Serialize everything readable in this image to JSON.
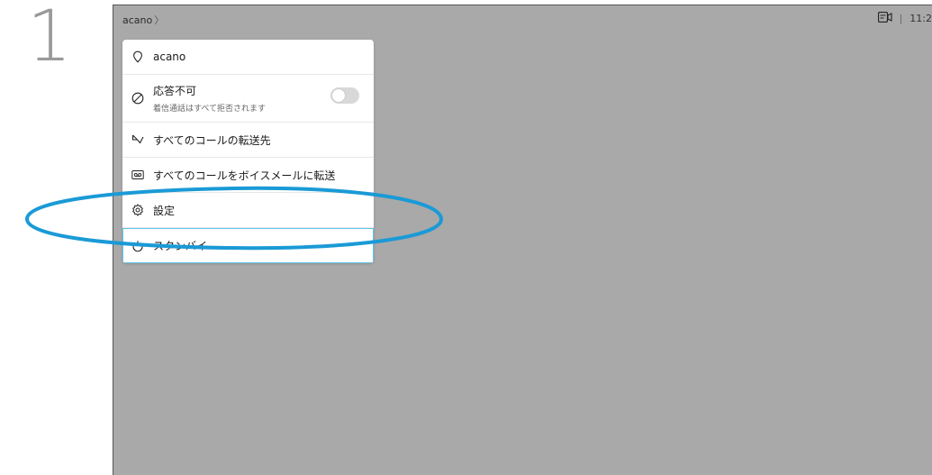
{
  "step": {
    "number": "1"
  },
  "topbar": {
    "breadcrumb": "acano",
    "breadcrumb_chevron": "〉",
    "separator": "|",
    "time": "11:2"
  },
  "menu": {
    "items": [
      {
        "label": "acano",
        "icon": "location-pin-icon"
      },
      {
        "label": "応答不可",
        "sublabel": "着信通話はすべて拒否されます",
        "icon": "do-not-disturb-icon",
        "toggle": false
      },
      {
        "label": "すべてのコールの転送先",
        "icon": "call-forward-icon"
      },
      {
        "label": "すべてのコールをボイスメールに転送",
        "icon": "voicemail-icon"
      },
      {
        "label": "設定",
        "icon": "gear-icon"
      },
      {
        "label": "スタンバイ",
        "icon": "power-icon",
        "selected": true
      }
    ]
  },
  "colors": {
    "screen_bg": "#a9a9a9",
    "highlight_ellipse": "#1a9ad6",
    "selection_outline": "#5fc4ec"
  }
}
